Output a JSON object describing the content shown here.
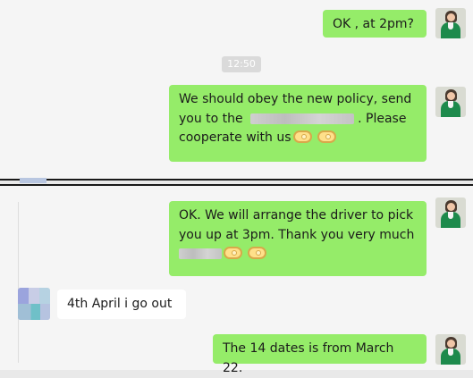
{
  "messages": {
    "m1": "OK , at 2pm?",
    "time": "12:50",
    "m2_line1": "We should obey the new policy, send",
    "m2_line2_pre": "you to the",
    "m2_line2_post": ". Please",
    "m2_line3": "cooperate with us",
    "m3_line1": "OK. We will arrange the driver to pick",
    "m3_line2": "you up at 3pm. Thank you very much",
    "m4": "4th April i go out",
    "m5": "The 14 dates is from March 22."
  },
  "colors": {
    "outgoing_bubble": "#95ec69",
    "incoming_bubble": "#ffffff",
    "background": "#f5f5f5"
  },
  "icons": {
    "avatar_self": "woman-green-shirt-avatar",
    "avatar_contact": "pixelated-avatar",
    "handshake": "handshake-emoji"
  }
}
